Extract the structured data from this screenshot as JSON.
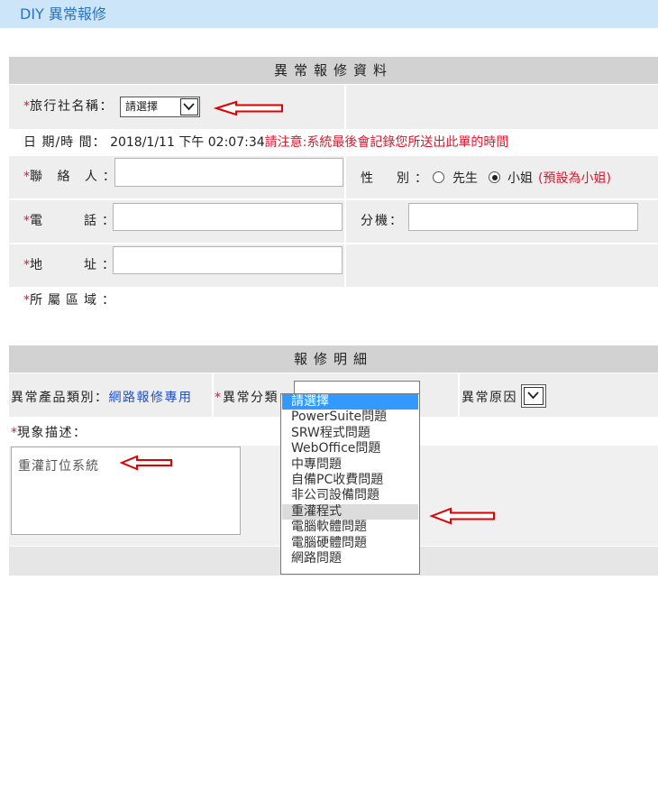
{
  "page": {
    "title": "DIY 異常報修"
  },
  "basic_info": {
    "header": "異常報修資料",
    "agency": {
      "required_mark": "*",
      "label": "旅行社名稱：",
      "selected": "請選擇"
    },
    "datetime": {
      "label": "日 期/時 間：",
      "value": "2018/1/11 下午 02:07:34",
      "notice": "請注意:系統最後會記錄您所送出此單的時間"
    },
    "contact": {
      "required_mark": "*",
      "label": "聯 絡 人：",
      "value": ""
    },
    "gender": {
      "label": "性　別：",
      "options": [
        "先生",
        "小姐"
      ],
      "selected": "小姐",
      "note": "(預設為小姐)"
    },
    "phone": {
      "required_mark": "*",
      "label": "電　　話：",
      "value": ""
    },
    "extension": {
      "label": "分機：",
      "value": ""
    },
    "address": {
      "required_mark": "*",
      "label": "地　　址：",
      "value": ""
    },
    "region": {
      "required_mark": "*",
      "label": "所屬區域："
    }
  },
  "repair_detail": {
    "header": "報修明細",
    "product_type": {
      "label": "異常產品類別：",
      "value": "網路報修專用"
    },
    "category": {
      "required_mark": "*",
      "label": "異常分類",
      "selected": "請選擇",
      "hovered": "重灌程式",
      "options": [
        "請選擇",
        "PowerSuite問題",
        "SRW程式問題",
        "WebOffice問題",
        "中專問題",
        "自備PC收費問題",
        "非公司設備問題",
        "重灌程式",
        "電腦軟體問題",
        "電腦硬體問題",
        "網路問題"
      ]
    },
    "reason": {
      "label": "異常原因"
    },
    "description": {
      "required_mark": "*",
      "label": "現象描述：",
      "value": "重灌訂位系統"
    }
  },
  "colors": {
    "title_bar": "#cde5f8",
    "title_text": "#2a73c2",
    "section_header": "#d2d2d2",
    "row_background": "#eeeeee",
    "required_mark": "#e4142b",
    "product_value": "#1a4fd8",
    "option_selected": "#3399ff",
    "option_hovered": "#dcdcdc",
    "annotation_arrow": "#e00000"
  },
  "icons": {
    "select_arrow": "chevron-down-icon",
    "annotation": "red-arrow-left-icon"
  }
}
